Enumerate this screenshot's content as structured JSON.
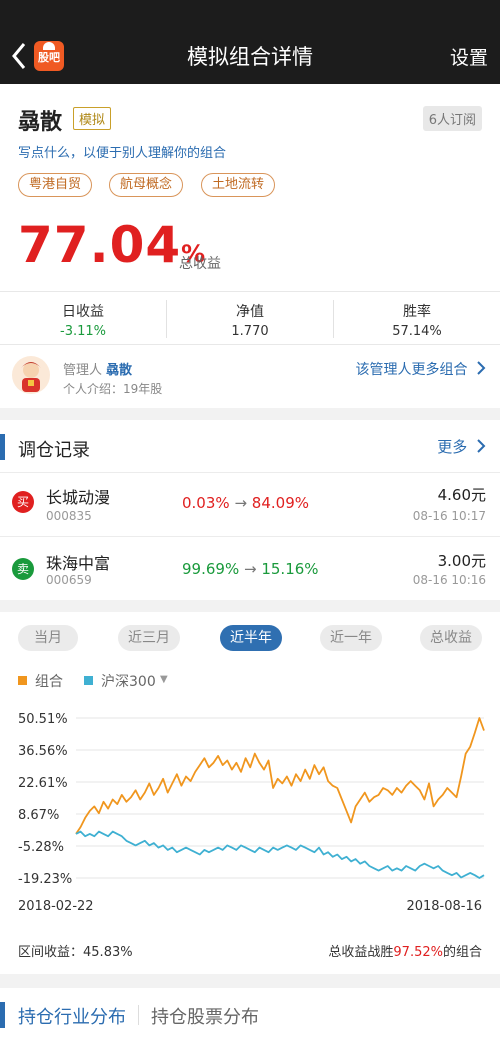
{
  "header": {
    "title": "模拟组合详情",
    "settings_label": "设置",
    "logo_text": "股吧",
    "accent": "#f05a23"
  },
  "portfolio": {
    "name": "骉散",
    "sim_tag": "模拟",
    "subscribers": "6人订阅",
    "description": "写点什么，以便于别人理解你的组合",
    "tags": [
      "粤港自贸",
      "航母概念",
      "土地流转"
    ],
    "total_return_value": "77.04",
    "total_return_unit": "%",
    "total_return_label": "总收益",
    "stats": [
      {
        "label": "日收益",
        "value": "-3.11%"
      },
      {
        "label": "净值",
        "value": "1.770"
      },
      {
        "label": "胜率",
        "value": "57.14%"
      }
    ]
  },
  "manager": {
    "role_label": "管理人",
    "name": "骉散",
    "intro": "个人介绍：19年股",
    "more_label": "该管理人更多组合"
  },
  "trades": {
    "title": "调仓记录",
    "more_label": "更多",
    "rows": [
      {
        "action": "买",
        "action_color": "#e02020",
        "name": "长城动漫",
        "code": "000835",
        "change_from": "0.03%",
        "arrow": "→",
        "change_to": "84.09%",
        "change_color": "#e02020",
        "price": "4.60元",
        "time": "08-16  10:17"
      },
      {
        "action": "卖",
        "action_color": "#1a9a3c",
        "name": "珠海中富",
        "code": "000659",
        "change_from": "99.69%",
        "arrow": "→",
        "change_to": "15.16%",
        "change_color": "#1a9a3c",
        "price": "3.00元",
        "time": "08-16  10:16"
      }
    ]
  },
  "chart_section": {
    "periods": [
      "当月",
      "近三月",
      "近半年",
      "近一年",
      "总收益"
    ],
    "active_period": "近半年",
    "interval_label": "区间收益：",
    "interval_value": "45.83%",
    "beat_prefix": "总收益战胜",
    "beat_value": "97.52%",
    "beat_suffix": "的组合"
  },
  "chart_data": {
    "type": "line",
    "x_start": "2018-02-22",
    "x_end": "2018-08-16",
    "xlabel_ticks": [
      "2018-02-22",
      "2018-08-16"
    ],
    "ytick_labels": [
      "50.51%",
      "36.56%",
      "22.61%",
      "8.67%",
      "-5.28%",
      "-19.23%"
    ],
    "ylim": [
      -19.23,
      50.51
    ],
    "grid": true,
    "legend_position": "top-left",
    "series": [
      {
        "name": "组合",
        "color": "#f0961e",
        "values": [
          0,
          3,
          7,
          10,
          12,
          9,
          14,
          11,
          15,
          13,
          17,
          14,
          16,
          19,
          15,
          18,
          22,
          17,
          20,
          24,
          18,
          22,
          26,
          21,
          25,
          23,
          27,
          30,
          33,
          29,
          31,
          34,
          30,
          32,
          28,
          31,
          27,
          33,
          29,
          35,
          31,
          28,
          32,
          20,
          24,
          22,
          25,
          21,
          26,
          23,
          28,
          24,
          30,
          26,
          29,
          23,
          21,
          20,
          15,
          10,
          5,
          12,
          15,
          18,
          14,
          16,
          17,
          20,
          19,
          17,
          20,
          18,
          21,
          23,
          21,
          19,
          15,
          22,
          12,
          15,
          17,
          20,
          18,
          16,
          25,
          35,
          38,
          44,
          50.51,
          45
        ]
      },
      {
        "name": "沪深300",
        "color": "#3fb0d2",
        "values": [
          0,
          1,
          -1,
          0,
          -1,
          1,
          0,
          -1,
          1,
          0,
          -1,
          -3,
          -4,
          -5,
          -4,
          -3,
          -5,
          -4,
          -6,
          -5,
          -7,
          -6,
          -8,
          -7,
          -6,
          -7,
          -8,
          -9,
          -7,
          -8,
          -7,
          -6,
          -7,
          -5,
          -6,
          -7,
          -5,
          -6,
          -7,
          -8,
          -6,
          -7,
          -8,
          -6,
          -7,
          -6,
          -5,
          -6,
          -7,
          -5,
          -6,
          -7,
          -8,
          -6,
          -9,
          -8,
          -10,
          -9,
          -11,
          -10,
          -12,
          -11,
          -13,
          -12,
          -14,
          -15,
          -16,
          -15,
          -14,
          -16,
          -15,
          -16,
          -14,
          -15,
          -16,
          -14,
          -13,
          -14,
          -15,
          -14,
          -16,
          -17,
          -18,
          -17,
          -19,
          -18,
          -17,
          -18,
          -19.23,
          -18
        ]
      }
    ]
  },
  "holdings": {
    "tab_industry": "持仓行业分布",
    "tab_stocks": "持仓股票分布"
  }
}
